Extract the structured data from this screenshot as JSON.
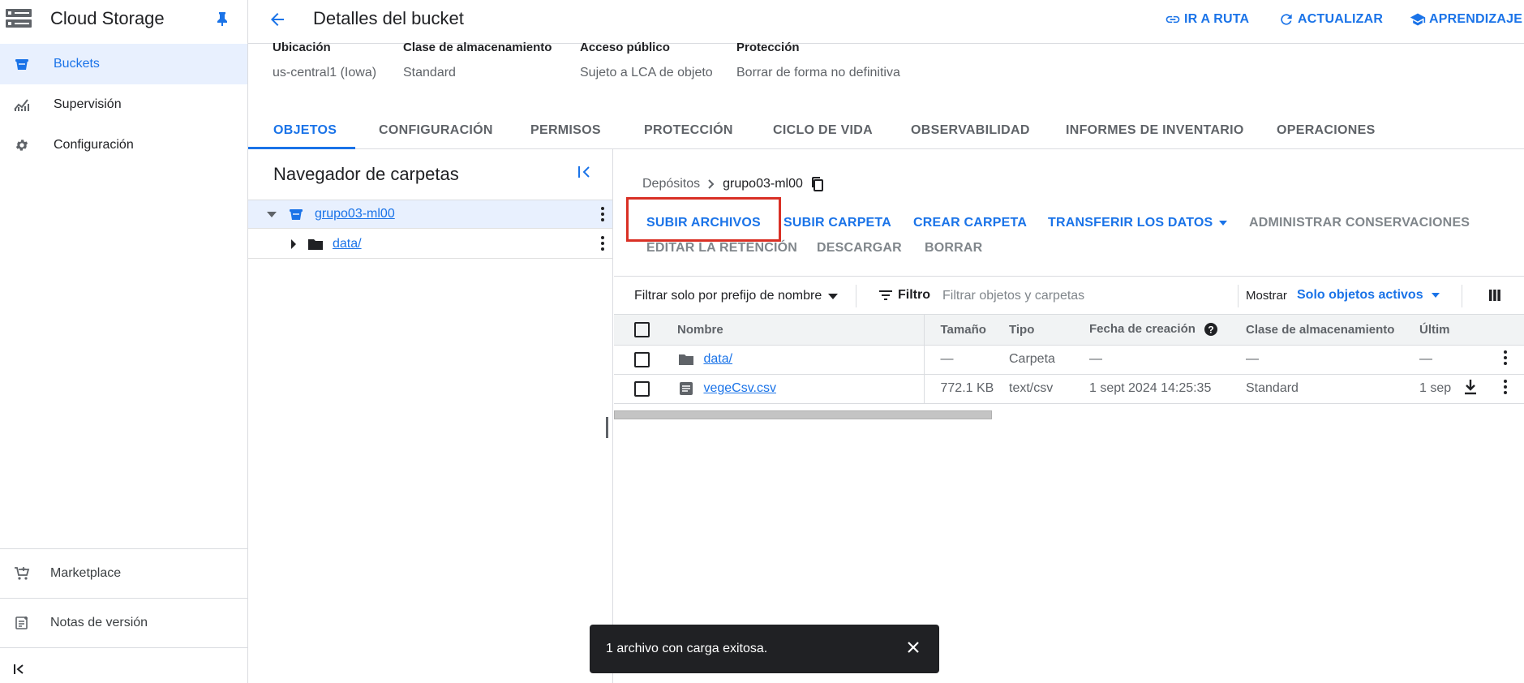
{
  "app": {
    "title": "Cloud Storage",
    "accent_color": "#1a73e8"
  },
  "sidebar": {
    "items": [
      {
        "label": "Buckets",
        "icon": "bucket-icon",
        "active": true
      },
      {
        "label": "Supervisión",
        "icon": "monitoring-chart-icon",
        "active": false
      },
      {
        "label": "Configuración",
        "icon": "gear-icon",
        "active": false
      }
    ],
    "bottom_items": [
      {
        "label": "Marketplace",
        "icon": "shopping-cart-icon"
      },
      {
        "label": "Notas de versión",
        "icon": "release-notes-icon"
      }
    ],
    "collapse_icon": "collapse-sidebar-icon"
  },
  "header": {
    "title": "Detalles del bucket",
    "actions": [
      {
        "label": "IR A RUTA",
        "icon": "link-icon"
      },
      {
        "label": "ACTUALIZAR",
        "icon": "refresh-icon"
      },
      {
        "label": "APRENDIZAJE",
        "icon": "school-icon"
      }
    ]
  },
  "bucket_info": [
    {
      "label": "Ubicación",
      "value": "us-central1 (Iowa)"
    },
    {
      "label": "Clase de almacenamiento",
      "value": "Standard"
    },
    {
      "label": "Acceso público",
      "value": "Sujeto a LCA de objeto"
    },
    {
      "label": "Protección",
      "value": "Borrar de forma no definitiva"
    }
  ],
  "tabs": [
    {
      "label": "OBJETOS",
      "active": true
    },
    {
      "label": "CONFIGURACIÓN"
    },
    {
      "label": "PERMISOS"
    },
    {
      "label": "PROTECCIÓN"
    },
    {
      "label": "CICLO DE VIDA"
    },
    {
      "label": "OBSERVABILIDAD"
    },
    {
      "label": "INFORMES DE INVENTARIO"
    },
    {
      "label": "OPERACIONES"
    }
  ],
  "folder_browser": {
    "title": "Navegador de carpetas",
    "bucket": "grupo03-ml00",
    "folders": [
      "data/"
    ]
  },
  "breadcrumb": {
    "root": "Depósitos",
    "current": "grupo03-ml00"
  },
  "toolbar": {
    "upload_files": "SUBIR ARCHIVOS",
    "upload_folder": "SUBIR CARPETA",
    "create_folder": "CREAR CARPETA",
    "transfer_data": "TRANSFERIR LOS DATOS",
    "manage_holds": "ADMINISTRAR CONSERVACIONES",
    "edit_retention": "EDITAR LA RETENCIÓN",
    "download": "DESCARGAR",
    "delete": "BORRAR"
  },
  "filter": {
    "prefix_select": "Filtrar solo por prefijo de nombre",
    "filter_label": "Filtro",
    "placeholder": "Filtrar objetos y carpetas",
    "show_label": "Mostrar",
    "show_value": "Solo objetos activos"
  },
  "table": {
    "columns": [
      "Nombre",
      "Tamaño",
      "Tipo",
      "Fecha de creación",
      "Clase de almacenamiento",
      "Últim"
    ],
    "rows": [
      {
        "name": "data/",
        "size": "—",
        "type": "Carpeta",
        "created": "—",
        "storage_class": "—",
        "last": "—",
        "icon": "folder-icon"
      },
      {
        "name": "vegeCsv.csv",
        "size": "772.1 KB",
        "type": "text/csv",
        "created": "1 sept 2024 14:25:35",
        "storage_class": "Standard",
        "last": "1 sep",
        "icon": "file-icon"
      }
    ]
  },
  "toast": {
    "message": "1 archivo con carga exitosa."
  }
}
